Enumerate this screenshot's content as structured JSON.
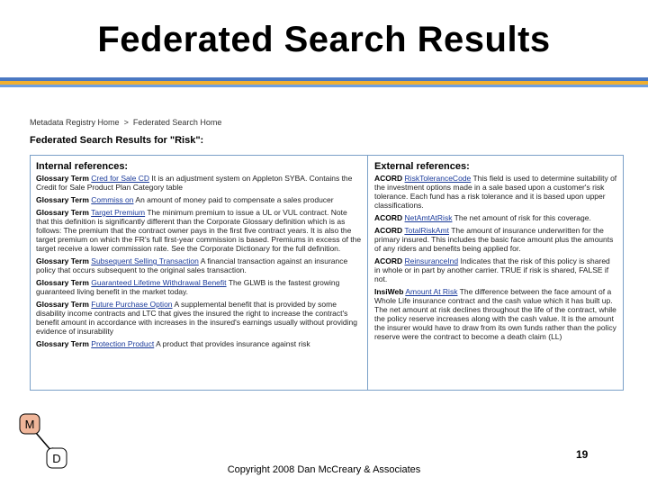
{
  "slide": {
    "title": "Federated Search Results",
    "page_number": "19",
    "copyright": "Copyright 2008 Dan McCreary & Associates"
  },
  "breadcrumb": {
    "items": [
      "Metadata Registry Home",
      "Federated Search Home"
    ],
    "separator": ">"
  },
  "results": {
    "heading": "Federated Search Results for \"Risk\":",
    "internal": {
      "title": "Internal references:",
      "entries": [
        {
          "type": "Glossary Term",
          "term": "Cred for Sale CD",
          "text": "It is an adjustment system on Appleton SYBA. Contains the Credit for Sale Product Plan Category table"
        },
        {
          "type": "Glossary Term",
          "term": "Commiss on",
          "text": "An amount of money paid to compensate a sales producer"
        },
        {
          "type": "Glossary Term",
          "term": "Target Premium",
          "text": "The minimum premium to issue a UL or VUL contract. Note that this definition is significantly different than the Corporate Glossary definition which is as follows: The premium that the contract owner pays in the first five contract years. It is also the target premium on which the FR's full first-year commission is based. Premiums in excess of the target receive a lower commission rate. See the Corporate Dictionary for the full definition."
        },
        {
          "type": "Glossary Term",
          "term": "Subsequent Selling Transaction",
          "text": "A financial transaction against an insurance policy that occurs subsequent to the original sales transaction."
        },
        {
          "type": "Glossary Term",
          "term": "Guaranteed Lifetime Withdrawal Benefit",
          "text": "The GLWB is the fastest growing guaranteed living benefit in the market today."
        },
        {
          "type": "Glossary Term",
          "term": "Future Purchase Option",
          "text": "A supplemental benefit that is provided by some disability income contracts and LTC that gives the insured the right to increase the contract's benefit amount in accordance with increases in the insured's earnings usually without providing evidence of insurability"
        },
        {
          "type": "Glossary Term",
          "term": "Protection Product",
          "text": "A product that provides insurance against risk"
        }
      ]
    },
    "external": {
      "title": "External references:",
      "entries": [
        {
          "type": "ACORD",
          "term": "RiskToleranceCode",
          "text": "This field is used to determine suitability of the investment options made in a sale based upon a customer's risk tolerance. Each fund has a risk tolerance and it is based upon upper classifications."
        },
        {
          "type": "ACORD",
          "term": "NetAmtAtRisk",
          "text": "The net amount of risk for this coverage."
        },
        {
          "type": "ACORD",
          "term": "TotalRiskAmt",
          "text": "The amount of insurance underwritten for the primary insured. This includes the basic face amount plus the amounts of any riders and benefits being applied for."
        },
        {
          "type": "ACORD",
          "term": "ReinsuranceInd",
          "text": "Indicates that the risk of this policy is shared in whole or in part by another carrier. TRUE if risk is shared, FALSE if not."
        },
        {
          "type": "InsiWeb",
          "term": "Amount At Risk",
          "text": "The difference between the face amount of a Whole Life insurance contract and the cash value which it has built up. The net amount at risk declines throughout the life of the contract, while the policy reserve increases along with the cash value. It is the amount the insurer would have to draw from its own funds rather than the policy reserve were the contract to become a death claim (LL)"
        }
      ]
    }
  },
  "diagram": {
    "nodes": [
      {
        "id": "M",
        "label": "M",
        "fill": "#f0b69a"
      },
      {
        "id": "D",
        "label": "D",
        "fill": "#ffffff"
      }
    ],
    "edge_color": "#000000"
  }
}
